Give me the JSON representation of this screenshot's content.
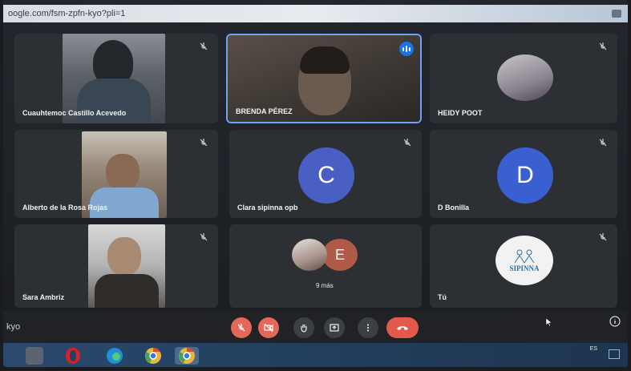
{
  "browser": {
    "url": "oogle.com/fsm-zpfn-kyo?pli=1"
  },
  "participants": [
    {
      "name": "Cuauhtemoc Castillo Acevedo",
      "muted": true
    },
    {
      "name": "BRENDA PÉREZ",
      "muted": false,
      "speaking": true
    },
    {
      "name": "HEIDY POOT",
      "muted": true
    },
    {
      "name": "Alberto de la Rosa Rojas",
      "muted": true
    },
    {
      "name": "Clara sipinna opb",
      "avatar_letter": "C",
      "avatar_color": "#4a5fc4",
      "muted": true
    },
    {
      "name": "D Bonilla",
      "avatar_letter": "D",
      "avatar_color": "#3a5fd0",
      "muted": true
    },
    {
      "name": "Sara Ambriz",
      "muted": true
    },
    {
      "name": "9 más",
      "avatar_letter": "E",
      "avatar_color": "#b05a4a"
    },
    {
      "name": "Tú",
      "logo_text": "SIPINNA",
      "muted": true
    }
  ],
  "meeting": {
    "code": "kyo"
  },
  "controls": {
    "items": [
      {
        "name": "mic-toggle",
        "icon": "mic-off-icon"
      },
      {
        "name": "camera-toggle",
        "icon": "camera-off-icon"
      },
      {
        "name": "raise-hand",
        "icon": "hand-icon"
      },
      {
        "name": "present-screen",
        "icon": "present-icon"
      },
      {
        "name": "more-options",
        "icon": "more-vert-icon"
      },
      {
        "name": "leave-call",
        "icon": "call-end-icon"
      }
    ]
  },
  "taskbar": {
    "tray_text": "ES",
    "apps": [
      "file-explorer-icon",
      "opera-icon",
      "edge-icon",
      "chrome-icon",
      "chrome-icon"
    ]
  },
  "colors": {
    "accent": "#1a73e8",
    "active_border": "#6fa3f5",
    "hangup": "#e35a4d",
    "control_red": "#e3685a"
  }
}
